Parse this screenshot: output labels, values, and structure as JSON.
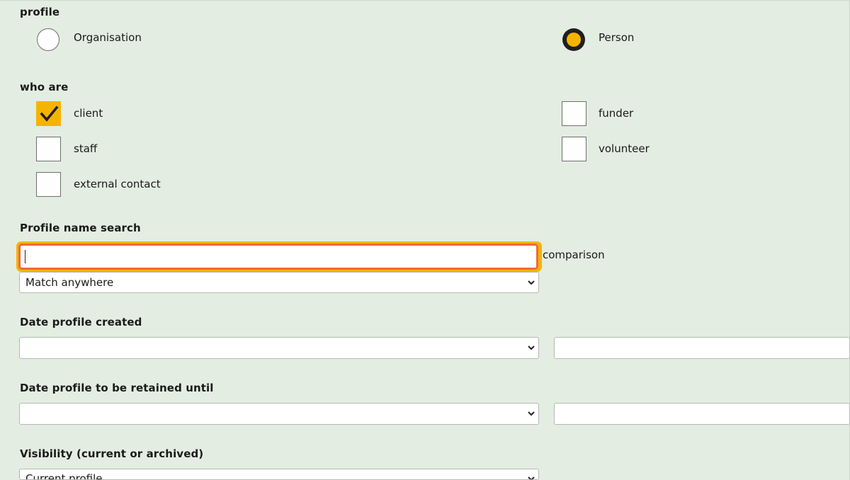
{
  "profile": {
    "heading": "profile",
    "options": [
      {
        "label": "Organisation",
        "checked": false
      },
      {
        "label": "Person",
        "checked": true
      }
    ]
  },
  "who_are": {
    "heading": "who are",
    "options": [
      {
        "label": "client",
        "checked": true
      },
      {
        "label": "funder",
        "checked": false
      },
      {
        "label": "staff",
        "checked": false
      },
      {
        "label": "volunteer",
        "checked": false
      },
      {
        "label": "external contact",
        "checked": false
      }
    ]
  },
  "name_search": {
    "heading": "Profile name search",
    "value": "",
    "comparison_label": "comparison",
    "comparison_selected": "Match anywhere"
  },
  "date_created": {
    "heading": "Date profile created",
    "operator_selected": "",
    "value": ""
  },
  "date_retained": {
    "heading": "Date profile to be retained until",
    "operator_selected": "",
    "value": ""
  },
  "visibility": {
    "heading": "Visibility (current or archived)",
    "selected": "Current profile"
  },
  "colors": {
    "background": "#e3ede1",
    "accent": "#f5b400",
    "focus_border": "#ee6b3a"
  }
}
